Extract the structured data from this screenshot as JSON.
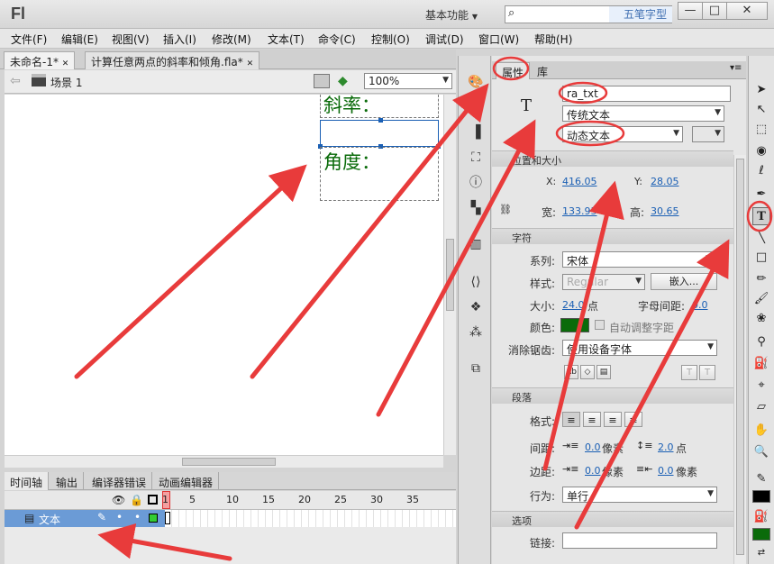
{
  "titlebar": {
    "logo": "Fl",
    "workspace": "基本功能",
    "search_tag": "五笔字型",
    "min_btn": "—",
    "max_btn": "□",
    "close_btn": "✕"
  },
  "menus": [
    "文件(F)",
    "编辑(E)",
    "视图(V)",
    "插入(I)",
    "修改(M)",
    "文本(T)",
    "命令(C)",
    "控制(O)",
    "调试(D)",
    "窗口(W)",
    "帮助(H)"
  ],
  "doc_tabs": [
    {
      "label": "未命名-1*",
      "close": "✕"
    },
    {
      "label": "计算任意两点的斜率和倾角.fla*",
      "close": "✕"
    }
  ],
  "editbar": {
    "back": "⇦",
    "scene": "场景 1",
    "zoom": "100%"
  },
  "stage": {
    "text1": "斜率：",
    "text2": "角度："
  },
  "timeline": {
    "tabs": [
      "时间轴",
      "输出",
      "编译器错误",
      "动画编辑器"
    ],
    "frame_numbers": [
      "1",
      "5",
      "10",
      "15",
      "20",
      "25",
      "30",
      "35"
    ],
    "layer_name": "文本"
  },
  "props": {
    "tabs": [
      "属性",
      "库"
    ],
    "type_icon": "T",
    "instance_name": "ra_txt",
    "text_engine": "传统文本",
    "text_type": "动态文本",
    "sections": {
      "position": "位置和大小",
      "char": "字符",
      "para": "段落",
      "options": "选项"
    },
    "x_label": "X:",
    "x_val": "416.05",
    "y_label": "Y:",
    "y_val": "28.05",
    "w_label": "宽:",
    "w_val": "133.95",
    "h_label": "高:",
    "h_val": "30.65",
    "family_label": "系列:",
    "family_val": "宋体",
    "style_label": "样式:",
    "style_val": "Regular",
    "embed_btn": "嵌入...",
    "size_label": "大小:",
    "size_val": "24.0",
    "size_unit": "点",
    "spacing_label": "字母间距:",
    "spacing_val": "0.0",
    "color_label": "颜色:",
    "color_value": "#0a6b0a",
    "autokern_label": "自动调整字距",
    "aa_label": "消除锯齿:",
    "aa_val": "使用设备字体",
    "format_label": "格式:",
    "indent_label": "间距:",
    "indent_val": "0.0",
    "indent_unit": "像素",
    "linesp_val": "2.0",
    "linesp_unit": "点",
    "margin_label": "边距:",
    "lmargin_val": "0.0",
    "lmargin_unit": "像素",
    "rmargin_val": "0.0",
    "rmargin_unit": "像素",
    "behavior_label": "行为:",
    "behavior_val": "单行",
    "link_label": "链接:"
  },
  "colors": {
    "annotation": "#e83b3b",
    "stage_text": "#0a6b0a",
    "selection": "#1a5fb4"
  }
}
